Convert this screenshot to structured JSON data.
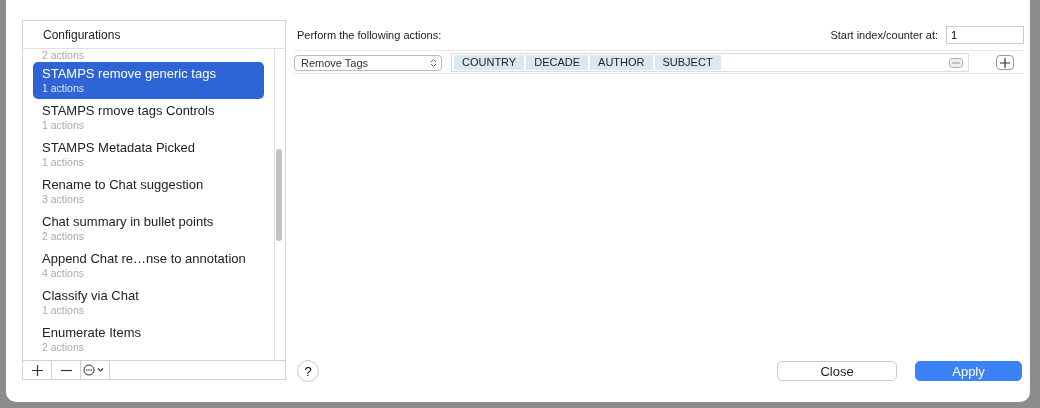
{
  "configurations": {
    "header": "Configurations",
    "items": [
      {
        "kind": "partial",
        "subtitle": "2 actions"
      },
      {
        "kind": "full",
        "name": "STAMPS remove generic tags",
        "subtitle": "1 actions",
        "selected": true
      },
      {
        "kind": "full",
        "name": "STAMPS rmove tags Controls",
        "subtitle": "1 actions",
        "selected": false
      },
      {
        "kind": "full",
        "name": "STAMPS Metadata Picked",
        "subtitle": "1 actions",
        "selected": false
      },
      {
        "kind": "full",
        "name": "Rename to Chat suggestion",
        "subtitle": "3 actions",
        "selected": false
      },
      {
        "kind": "full",
        "name": "Chat summary in bullet points",
        "subtitle": "2 actions",
        "selected": false
      },
      {
        "kind": "full",
        "name": "Append Chat re…nse to annotation",
        "subtitle": "4 actions",
        "selected": false
      },
      {
        "kind": "full",
        "name": "Classify via Chat",
        "subtitle": "1 actions",
        "selected": false
      },
      {
        "kind": "full",
        "name": "Enumerate Items",
        "subtitle": "2 actions",
        "selected": false
      }
    ]
  },
  "actions": {
    "heading": "Perform the following actions:",
    "start_label": "Start index/counter at:",
    "start_value": "1",
    "rows": [
      {
        "action": "Remove Tags",
        "tags": [
          "COUNTRY",
          "DECADE",
          "AUTHOR",
          "SUBJECT"
        ]
      }
    ]
  },
  "buttons": {
    "help": "?",
    "close": "Close",
    "apply": "Apply"
  }
}
